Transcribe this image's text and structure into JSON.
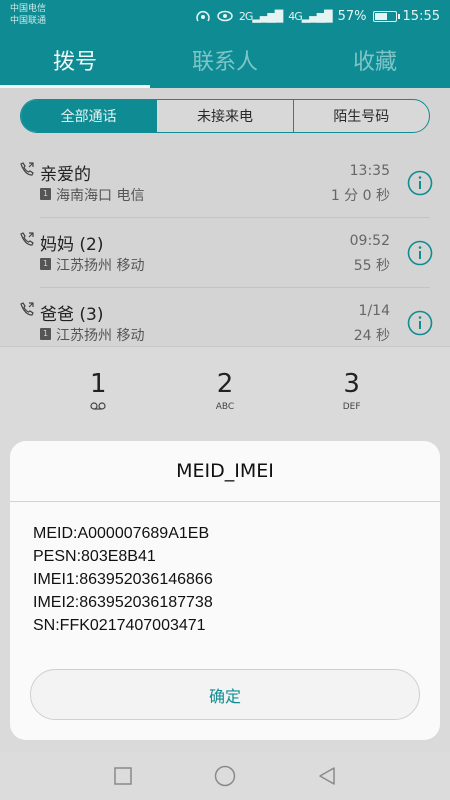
{
  "status": {
    "carrier1": "中国电信",
    "carrier2": "中国联通",
    "signal1": "2G",
    "signal2": "4G",
    "battery": "57%",
    "battery_level": 0.57,
    "time": "15:55"
  },
  "tabs": [
    {
      "label": "拨号",
      "active": true
    },
    {
      "label": "联系人",
      "active": false
    },
    {
      "label": "收藏",
      "active": false
    }
  ],
  "filter": [
    {
      "label": "全部通话",
      "active": true
    },
    {
      "label": "未接来电",
      "active": false
    },
    {
      "label": "陌生号码",
      "active": false
    }
  ],
  "calls": [
    {
      "name": "亲爱的",
      "sim": "1",
      "location": "海南海口 电信",
      "time": "13:35",
      "duration": "1 分 0 秒"
    },
    {
      "name": "妈妈 (2)",
      "sim": "1",
      "location": "江苏扬州 移动",
      "time": "09:52",
      "duration": "55 秒"
    },
    {
      "name": "爸爸 (3)",
      "sim": "1",
      "location": "江苏扬州 移动",
      "time": "1/14",
      "duration": "24 秒"
    }
  ],
  "dialpad": [
    {
      "num": "1",
      "sub": ""
    },
    {
      "num": "2",
      "sub": "ABC"
    },
    {
      "num": "3",
      "sub": "DEF"
    }
  ],
  "dialog": {
    "title": "MEID_IMEI",
    "lines": [
      "MEID:A000007689A1EB",
      "PESN:803E8B41",
      "IMEI1:863952036146866",
      "IMEI2:863952036187738",
      "SN:FFK0217407003471"
    ],
    "confirm": "确定"
  },
  "colors": {
    "accent": "#0f8c93",
    "dialog_bg": "#fafafa"
  }
}
